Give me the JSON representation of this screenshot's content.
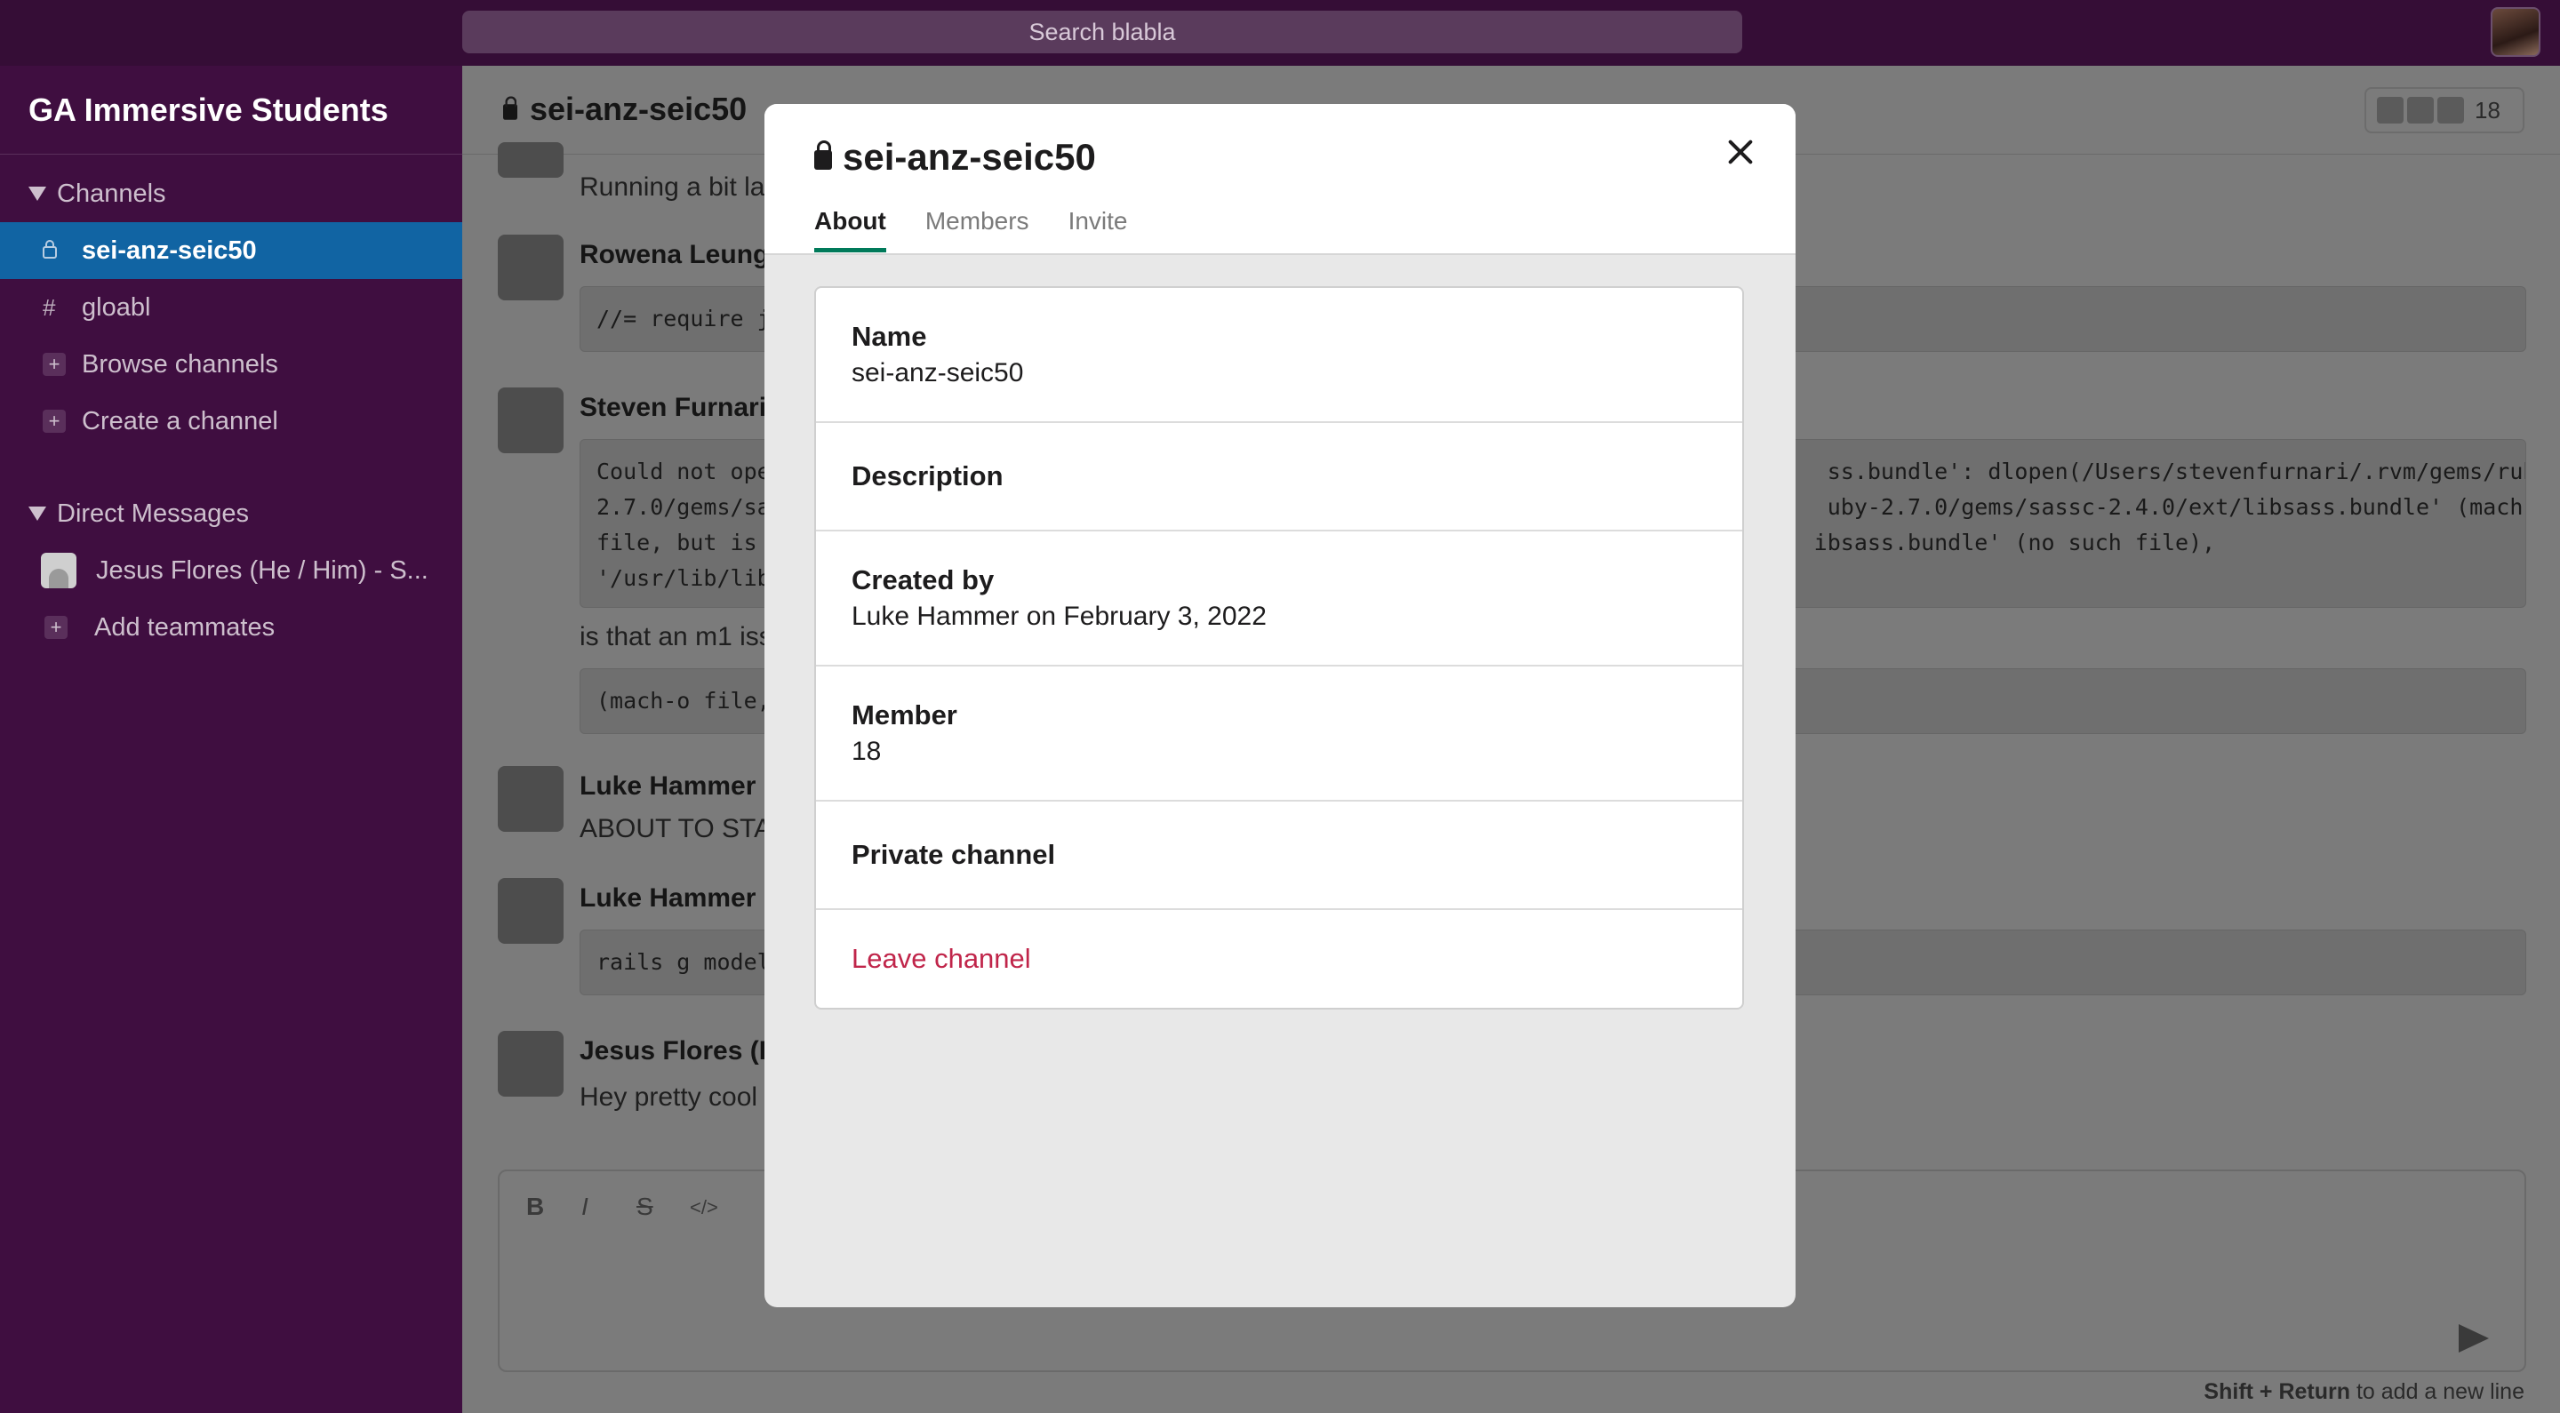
{
  "search": {
    "placeholder": "Search blabla"
  },
  "workspace": {
    "name": "GA Immersive Students"
  },
  "sidebar": {
    "channels_heading": "Channels",
    "channels": [
      {
        "glyph": "",
        "label": "sei-anz-seic50",
        "active": true
      },
      {
        "glyph": "#",
        "label": "gloabl"
      }
    ],
    "browse_label": "Browse channels",
    "create_label": "Create a channel",
    "dm_heading": "Direct Messages",
    "dms": [
      {
        "label": "Jesus Flores (He / Him) - S..."
      }
    ],
    "add_teammates_label": "Add teammates"
  },
  "channel": {
    "name": "sei-anz-seic50",
    "member_count": "18"
  },
  "messages": [
    {
      "author": "",
      "text": "Running a bit lat"
    },
    {
      "author": "Rowena Leung",
      "code": "//= require j"
    },
    {
      "author": "Steven Furnari",
      "code": "Could not ope                                                                               ss.bundle': dlopen(/Users/stevenfurnari/.rvm/gems/ruby-\n2.7.0/gems/sa                                                                               uby-2.7.0/gems/sassc-2.4.0/ext/libsass.bundle' (mach-o\nfile, but is                                                                               ibsass.bundle' (no such file),\n'/usr/lib/lib",
      "text": "is that an m1 iss",
      "code2": "(mach-o file,"
    },
    {
      "author": "Luke Hammer",
      "text": "ABOUT TO STA"
    },
    {
      "author": "Luke Hammer",
      "code": "rails g model"
    },
    {
      "author": "Jesus Flores (H",
      "text": "Hey pretty cool"
    }
  ],
  "composer": {
    "bold": "B",
    "italic": "I",
    "strike": "S",
    "code": "</>",
    "hint_bold": "Shift + Return",
    "hint_rest": " to add a new line"
  },
  "modal": {
    "title": "sei-anz-seic50",
    "tabs": [
      "About",
      "Members",
      "Invite"
    ],
    "name_label": "Name",
    "name_value": "sei-anz-seic50",
    "description_label": "Description",
    "created_label": "Created by",
    "created_value": "Luke Hammer on February 3, 2022",
    "member_label": "Member",
    "member_value": "18",
    "private_label": "Private channel",
    "leave_label": "Leave channel"
  }
}
